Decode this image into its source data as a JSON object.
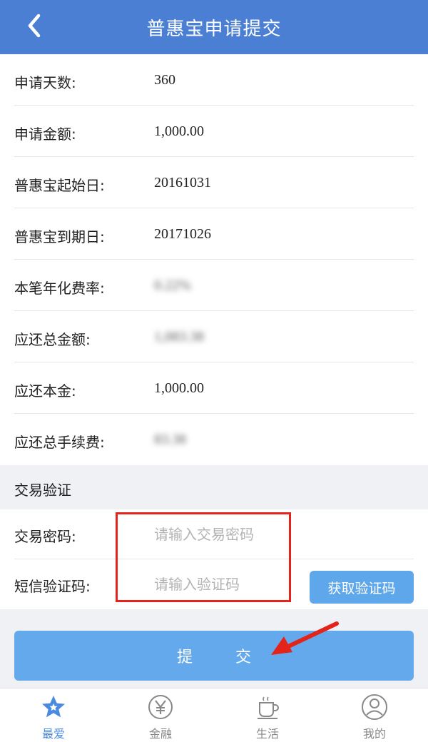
{
  "header": {
    "title": "普惠宝申请提交",
    "back_icon": "chevron-left-icon"
  },
  "details": [
    {
      "label": "申请天数:",
      "value": "360",
      "obscured": false
    },
    {
      "label": "申请金额:",
      "value": "1,000.00",
      "obscured": false
    },
    {
      "label": "普惠宝起始日:",
      "value": "20161031",
      "obscured": false
    },
    {
      "label": "普惠宝到期日:",
      "value": "20171026",
      "obscured": false
    },
    {
      "label": "本笔年化费率:",
      "value": "0.22%",
      "obscured": true
    },
    {
      "label": "应还总金额:",
      "value": "1,083.38",
      "obscured": true
    },
    {
      "label": "应还本金:",
      "value": "1,000.00",
      "obscured": false
    },
    {
      "label": "应还总手续费:",
      "value": "83.38",
      "obscured": true
    }
  ],
  "verification": {
    "section_title": "交易验证",
    "password_label": "交易密码:",
    "password_placeholder": "请输入交易密码",
    "password_value": "",
    "sms_label": "短信验证码:",
    "sms_placeholder": "请输入验证码",
    "sms_value": "",
    "get_code_label": "获取验证码"
  },
  "submit_label": "提交",
  "tabbar": [
    {
      "label": "最爱",
      "icon": "star-icon",
      "active": true
    },
    {
      "label": "金融",
      "icon": "yen-icon",
      "active": false
    },
    {
      "label": "生活",
      "icon": "cup-icon",
      "active": false
    },
    {
      "label": "我的",
      "icon": "user-icon",
      "active": false
    }
  ],
  "colors": {
    "header": "#4a7fd4",
    "button": "#64a9ec",
    "highlight": "#e3241b",
    "active_tab": "#4a8be0"
  }
}
